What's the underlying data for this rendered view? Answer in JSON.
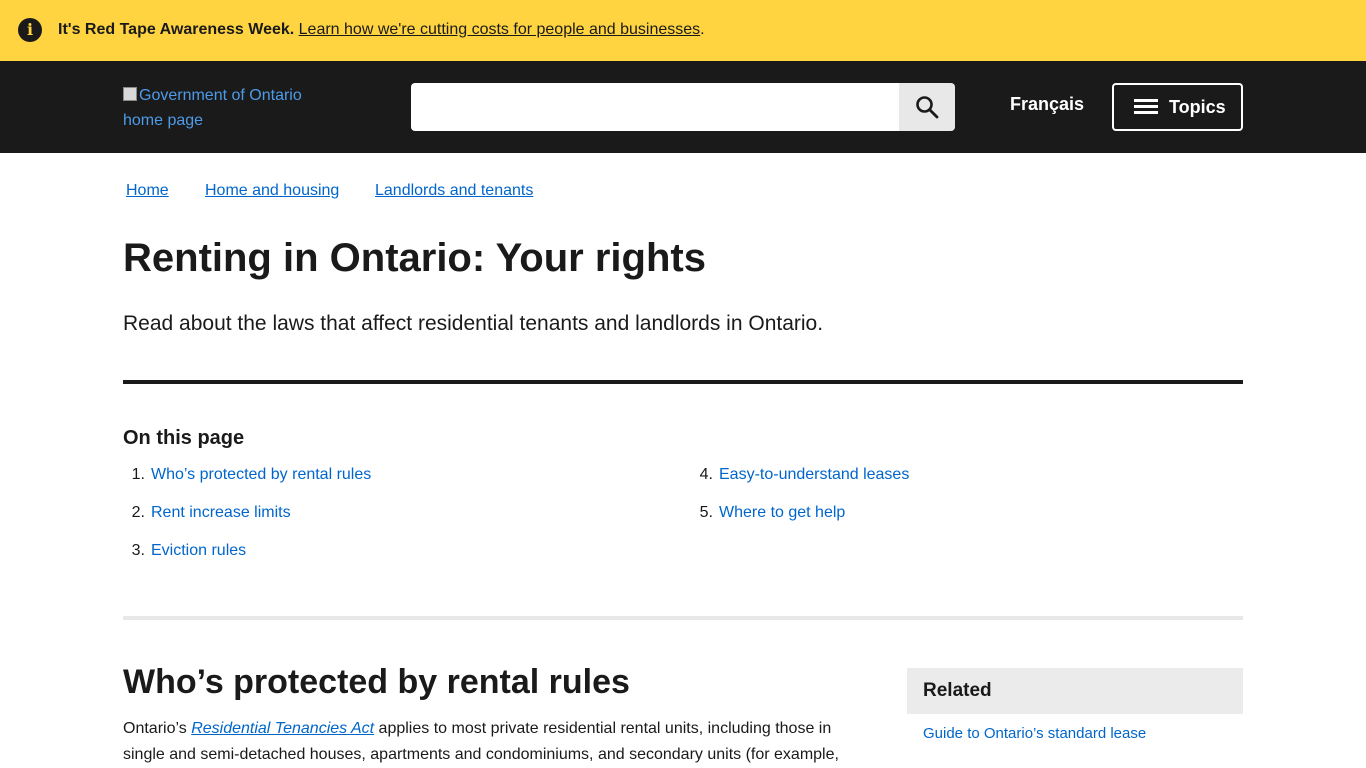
{
  "alert": {
    "icon": "info-icon",
    "bold_text": "It's Red Tape Awareness Week.",
    "link_text": "Learn how we're cutting costs for people and businesses",
    "trailing": "."
  },
  "header": {
    "logo_alt": "Government of Ontario home page",
    "search": {
      "value": "",
      "placeholder": "",
      "button_icon": "search-icon"
    },
    "language_link": "Français",
    "topics_button": "Topics",
    "topics_icon": "menu-icon"
  },
  "breadcrumb": [
    "Home",
    "Home and housing",
    "Landlords and tenants"
  ],
  "page": {
    "title": "Renting in Ontario: Your rights",
    "lead": "Read about the laws that affect residential tenants and landlords in Ontario."
  },
  "on_this_page": {
    "heading": "On this page",
    "items": [
      {
        "num": "1.",
        "label": "Who’s protected by rental rules"
      },
      {
        "num": "2.",
        "label": "Rent increase limits"
      },
      {
        "num": "3.",
        "label": "Eviction rules"
      },
      {
        "num": "4.",
        "label": "Easy-to-understand leases"
      },
      {
        "num": "5.",
        "label": "Where to get help"
      }
    ]
  },
  "section": {
    "heading": "Who’s protected by rental rules",
    "body_prefix": "Ontario’s ",
    "body_link": "Residential Tenancies Act",
    "body_suffix": " applies to most private residential rental units, including those in single and semi-detached houses, apartments and condominiums, and secondary units (for example,"
  },
  "related": {
    "heading": "Related",
    "links": [
      "Guide to Ontario’s standard lease"
    ]
  },
  "colors": {
    "alert_bg": "#ffd440",
    "header_bg": "#1a1a1a",
    "link": "#0066cc",
    "text": "#1a1a1a",
    "related_bg": "#ebebeb"
  }
}
